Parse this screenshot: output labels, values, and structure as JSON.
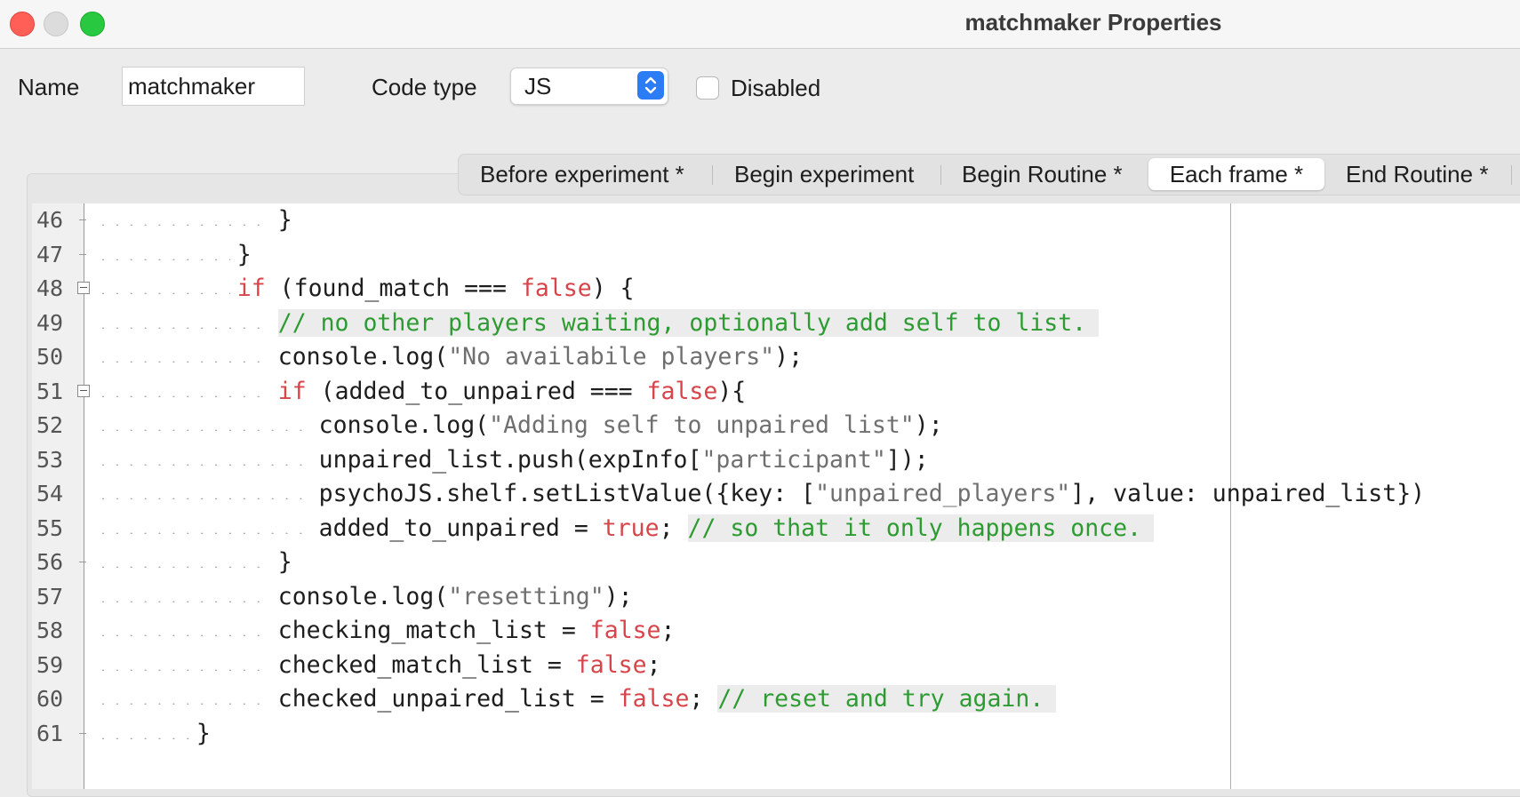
{
  "window": {
    "title": "matchmaker Properties"
  },
  "form": {
    "name_label": "Name",
    "name_value": "matchmaker",
    "code_type_label": "Code type",
    "code_type_value": "JS",
    "disabled_label": "Disabled",
    "disabled_checked": false
  },
  "tabs": [
    {
      "label": "Before experiment *",
      "active": false
    },
    {
      "label": "Begin experiment",
      "active": false
    },
    {
      "label": "Begin Routine *",
      "active": false
    },
    {
      "label": "Each frame *",
      "active": true
    },
    {
      "label": "End Routine *",
      "active": false
    }
  ],
  "editor": {
    "lines": [
      {
        "num": "46",
        "indent": 4,
        "fold": "line",
        "segments": [
          {
            "t": "}",
            "c": "p"
          }
        ]
      },
      {
        "num": "47",
        "indent": 3,
        "fold": "line",
        "segments": [
          {
            "t": "}",
            "c": "p"
          }
        ]
      },
      {
        "num": "48",
        "indent": 3,
        "fold": "box",
        "segments": [
          {
            "t": "if",
            "c": "kw"
          },
          {
            "t": " (found_match === ",
            "c": "p"
          },
          {
            "t": "false",
            "c": "kw"
          },
          {
            "t": ") {",
            "c": "p"
          }
        ]
      },
      {
        "num": "49",
        "indent": 4,
        "fold": "none",
        "segments": [
          {
            "t": "// no other players waiting, optionally add self to list.",
            "c": "cm"
          }
        ]
      },
      {
        "num": "50",
        "indent": 4,
        "fold": "none",
        "segments": [
          {
            "t": "console.log(",
            "c": "p"
          },
          {
            "t": "\"No availabile players\"",
            "c": "str"
          },
          {
            "t": ");",
            "c": "p"
          }
        ]
      },
      {
        "num": "51",
        "indent": 4,
        "fold": "box",
        "segments": [
          {
            "t": "if",
            "c": "kw"
          },
          {
            "t": " (added_to_unpaired === ",
            "c": "p"
          },
          {
            "t": "false",
            "c": "kw"
          },
          {
            "t": "){",
            "c": "p"
          }
        ]
      },
      {
        "num": "52",
        "indent": 5,
        "fold": "none",
        "segments": [
          {
            "t": "console.log(",
            "c": "p"
          },
          {
            "t": "\"Adding self to unpaired list\"",
            "c": "str"
          },
          {
            "t": ");",
            "c": "p"
          }
        ]
      },
      {
        "num": "53",
        "indent": 5,
        "fold": "none",
        "segments": [
          {
            "t": "unpaired_list.push(expInfo[",
            "c": "p"
          },
          {
            "t": "\"participant\"",
            "c": "str"
          },
          {
            "t": "]);",
            "c": "p"
          }
        ]
      },
      {
        "num": "54",
        "indent": 5,
        "fold": "none",
        "segments": [
          {
            "t": "psychoJS.shelf.setListValue({key: [",
            "c": "p"
          },
          {
            "t": "\"unpaired_players\"",
            "c": "str"
          },
          {
            "t": "], value: unpaired_list})",
            "c": "p"
          }
        ]
      },
      {
        "num": "55",
        "indent": 5,
        "fold": "none",
        "segments": [
          {
            "t": "added_to_unpaired = ",
            "c": "p"
          },
          {
            "t": "true",
            "c": "kw"
          },
          {
            "t": "; ",
            "c": "p"
          },
          {
            "t": "// so that it only happens once.",
            "c": "cm"
          }
        ]
      },
      {
        "num": "56",
        "indent": 4,
        "fold": "line",
        "segments": [
          {
            "t": "}",
            "c": "p"
          }
        ]
      },
      {
        "num": "57",
        "indent": 4,
        "fold": "none",
        "segments": [
          {
            "t": "console.log(",
            "c": "p"
          },
          {
            "t": "\"resetting\"",
            "c": "str"
          },
          {
            "t": ");",
            "c": "p"
          }
        ]
      },
      {
        "num": "58",
        "indent": 4,
        "fold": "none",
        "segments": [
          {
            "t": "checking_match_list = ",
            "c": "p"
          },
          {
            "t": "false",
            "c": "kw"
          },
          {
            "t": ";",
            "c": "p"
          }
        ]
      },
      {
        "num": "59",
        "indent": 4,
        "fold": "none",
        "segments": [
          {
            "t": "checked_match_list = ",
            "c": "p"
          },
          {
            "t": "false",
            "c": "kw"
          },
          {
            "t": ";",
            "c": "p"
          }
        ]
      },
      {
        "num": "60",
        "indent": 4,
        "fold": "none",
        "segments": [
          {
            "t": "checked_unpaired_list = ",
            "c": "p"
          },
          {
            "t": "false",
            "c": "kw"
          },
          {
            "t": "; ",
            "c": "p"
          },
          {
            "t": "// reset and try again.",
            "c": "cm"
          }
        ]
      },
      {
        "num": "61",
        "indent": 2,
        "fold": "line",
        "segments": [
          {
            "t": "}",
            "c": "p"
          }
        ]
      }
    ]
  },
  "colors": {
    "keyword": "#d7454a",
    "string": "#6f6f6f",
    "comment": "#2e9b32",
    "accent": "#2c7cf6"
  }
}
